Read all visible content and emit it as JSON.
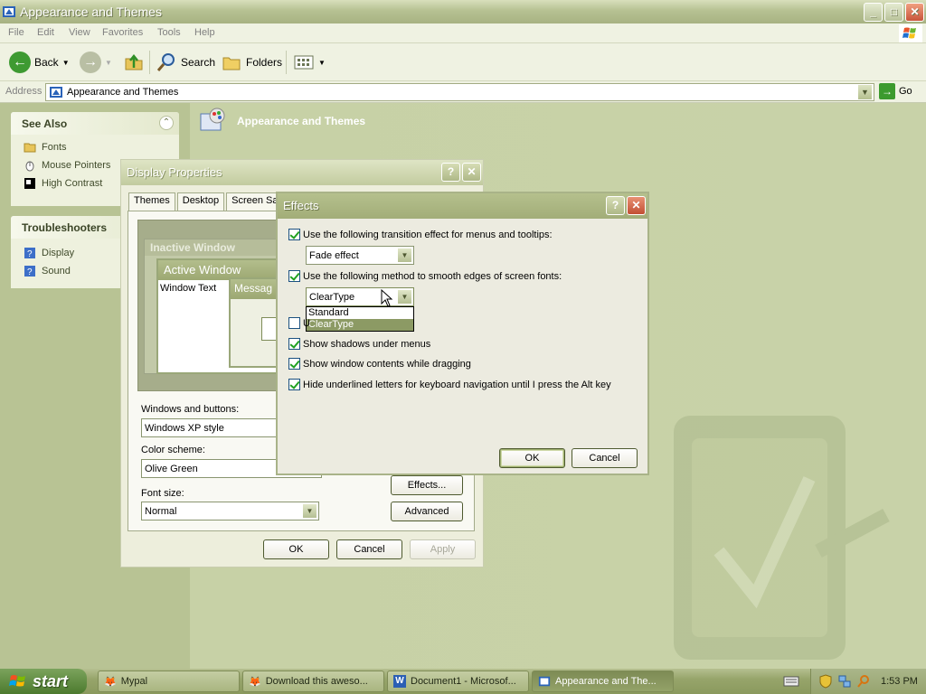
{
  "window": {
    "title": "Appearance and Themes",
    "controls": {
      "minimize": "_",
      "maximize": "□",
      "close": "✕"
    }
  },
  "menu": [
    "File",
    "Edit",
    "View",
    "Favorites",
    "Tools",
    "Help"
  ],
  "toolbar": {
    "back_label": "Back",
    "search_label": "Search",
    "folders_label": "Folders"
  },
  "address": {
    "label": "Address",
    "value": "Appearance and Themes",
    "go_label": "Go"
  },
  "see_also": {
    "title": "See Also",
    "items": [
      "Fonts",
      "Mouse Pointers",
      "High Contrast"
    ]
  },
  "troubleshooters": {
    "title": "Troubleshooters",
    "items": [
      "Display",
      "Sound"
    ]
  },
  "page_heading": "Appearance and Themes",
  "display_properties": {
    "title": "Display Properties",
    "tabs": [
      "Themes",
      "Desktop",
      "Screen Sav"
    ],
    "preview": {
      "inactive_window": "Inactive Window",
      "active_window": "Active Window",
      "window_text": "Window Text",
      "message_box": "Messag"
    },
    "windows_buttons_label": "Windows and buttons:",
    "windows_buttons_value": "Windows XP style",
    "color_scheme_label": "Color scheme:",
    "color_scheme_value": "Olive Green",
    "font_size_label": "Font size:",
    "font_size_value": "Normal",
    "effects_button": "Effects...",
    "advanced_button": "Advanced",
    "ok": "OK",
    "cancel": "Cancel",
    "apply": "Apply"
  },
  "effects": {
    "title": "Effects",
    "transition": {
      "label": "Use the following transition effect for menus and tooltips:",
      "checked": true,
      "value": "Fade effect"
    },
    "smoothing": {
      "label": "Use the following method to smooth edges of screen fonts:",
      "checked": true,
      "value": "ClearType",
      "options": [
        "Standard",
        "ClearType"
      ],
      "selected_option": "ClearType"
    },
    "large_icons": {
      "label": "U",
      "checked": false
    },
    "shadows": {
      "label": "Show shadows under menus",
      "checked": true
    },
    "drag_contents": {
      "label": "Show window contents while dragging",
      "checked": true
    },
    "hide_underlines": {
      "label": "Hide underlined letters for keyboard navigation until I press the Alt key",
      "checked": true
    },
    "ok": "OK",
    "cancel": "Cancel"
  },
  "taskbar": {
    "start_label": "start",
    "tasks": [
      "Mypal",
      "Download this aweso...",
      "Document1 - Microsof...",
      "Appearance and The..."
    ],
    "active_task_index": 3,
    "clock": "1:53 PM"
  },
  "colors": {
    "theme_olive": "#b8c394",
    "dialog_bg": "#ecebe0",
    "selection": "#8c9a64"
  }
}
